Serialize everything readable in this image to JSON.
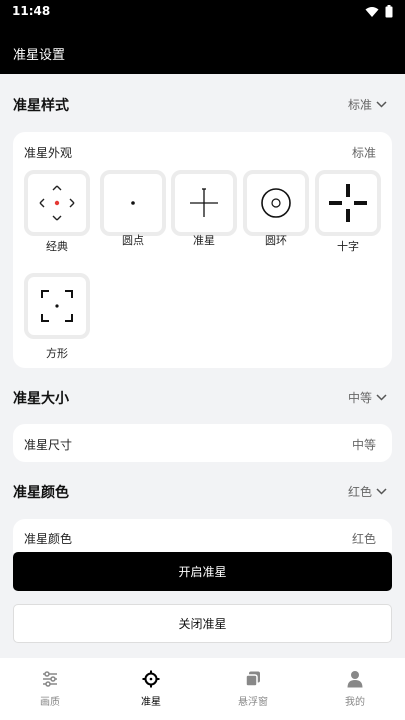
{
  "status_bar": {
    "time": "11:48"
  },
  "app_bar": {
    "title": "准星设置"
  },
  "style_section": {
    "title": "准星样式",
    "value": "标准",
    "card_label": "准星外观",
    "card_value": "标准",
    "items": [
      {
        "label": "经典",
        "icon": "classic-reticle-icon"
      },
      {
        "label": "圆点",
        "icon": "dot-reticle-icon"
      },
      {
        "label": "准星",
        "icon": "crosshair-reticle-icon"
      },
      {
        "label": "圆环",
        "icon": "ring-reticle-icon"
      },
      {
        "label": "十字",
        "icon": "cross-reticle-icon"
      },
      {
        "label": "方形",
        "icon": "square-reticle-icon"
      }
    ],
    "accent_color": "#e53935"
  },
  "size_section": {
    "title": "准星大小",
    "value": "中等",
    "card_label": "准星尺寸",
    "card_value": "中等"
  },
  "color_section": {
    "title": "准星颜色",
    "value": "红色",
    "card_label": "准星颜色",
    "card_value": "红色"
  },
  "buttons": {
    "enable": "开启准星",
    "disable": "关闭准星"
  },
  "bottom_nav": {
    "items": [
      {
        "label": "画质",
        "icon": "sliders-icon"
      },
      {
        "label": "准星",
        "icon": "crosshair-icon"
      },
      {
        "label": "悬浮窗",
        "icon": "floating-window-icon"
      },
      {
        "label": "我的",
        "icon": "person-icon"
      }
    ],
    "active_index": 1
  }
}
